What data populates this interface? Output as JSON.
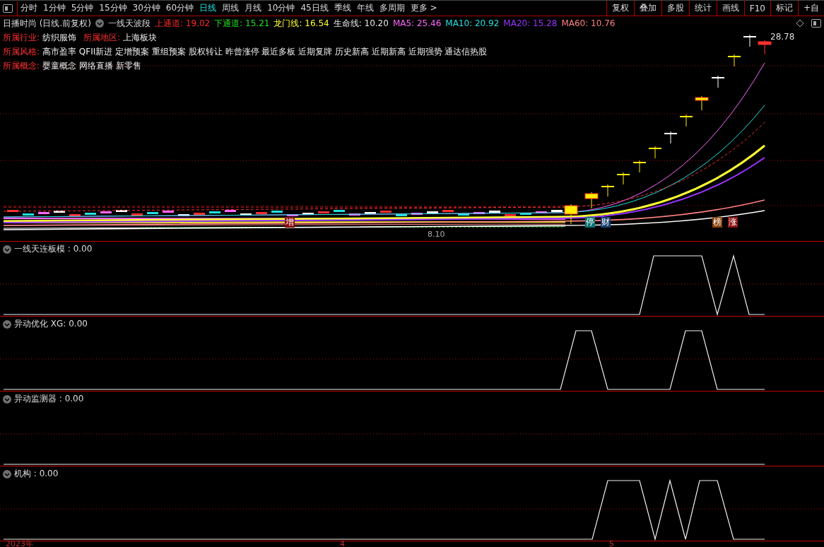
{
  "toolbar": {
    "periods": [
      {
        "label": "分时",
        "selected": false
      },
      {
        "label": "1分钟",
        "selected": false
      },
      {
        "label": "5分钟",
        "selected": false
      },
      {
        "label": "15分钟",
        "selected": false
      },
      {
        "label": "30分钟",
        "selected": false
      },
      {
        "label": "60分钟",
        "selected": false
      },
      {
        "label": "日线",
        "selected": true
      },
      {
        "label": "周线",
        "selected": false
      },
      {
        "label": "月线",
        "selected": false
      },
      {
        "label": "10分钟",
        "selected": false
      },
      {
        "label": "45日线",
        "selected": false
      },
      {
        "label": "季线",
        "selected": false
      },
      {
        "label": "年线",
        "selected": false
      },
      {
        "label": "多周期",
        "selected": false
      },
      {
        "label": "更多 >",
        "selected": false
      }
    ],
    "tools": [
      "复权",
      "叠加",
      "多股",
      "统计",
      "画线",
      "F10",
      "标记",
      "+自"
    ]
  },
  "header": {
    "stock": "日播时尚 (日线.前复权)",
    "indicator": "一线天波段",
    "values": [
      {
        "text": "上通道: 19.02",
        "color": "#ff2a2a"
      },
      {
        "text": "下通道: 15.21",
        "color": "#22e022"
      },
      {
        "text": "龙门线: 16.54",
        "color": "#ffff33"
      },
      {
        "text": "生命线: 10.20",
        "color": "#e8e8e8"
      },
      {
        "text": "MA5: 25.46",
        "color": "#ff66ff"
      },
      {
        "text": "MA10: 20.92",
        "color": "#22e0e0"
      },
      {
        "text": "MA20: 15.28",
        "color": "#9933ff"
      },
      {
        "text": "MA60: 10.76",
        "color": "#ff8080"
      }
    ]
  },
  "info": [
    [
      {
        "label": "所属行业:",
        "value": "纺织服饰"
      },
      {
        "label": "所属地区:",
        "value": "上海板块"
      }
    ],
    [
      {
        "label": "所属风格:",
        "value": "高市盈率 QFII新进 定增预案 重组预案 股权转让 昨曾涨停 最近多板 近期复牌 历史新高 近期新高 近期强势 通达信热股"
      }
    ],
    [
      {
        "label": "所属概念:",
        "value": "婴童概念 网络直播 新零售"
      }
    ]
  ],
  "main_chart": {
    "high_label": "28.78",
    "low_label": "8.10",
    "markers": [
      {
        "text": "增",
        "color": "#8b0d0d"
      },
      {
        "text": "停",
        "color": "#0d7373"
      },
      {
        "text": "财",
        "color": "#163d6e"
      },
      {
        "text": "榜",
        "color": "#8a4510"
      },
      {
        "text": "涨",
        "color": "#8b1212"
      }
    ]
  },
  "panels": [
    {
      "title": "一线天连板模 : 0.00"
    },
    {
      "title": "异动优化 XG: 0.00"
    },
    {
      "title": "异动监测器 : 0.00"
    },
    {
      "title": "机构 : 0.00"
    }
  ],
  "time_axis": [
    "2023年",
    "4",
    "5"
  ]
}
